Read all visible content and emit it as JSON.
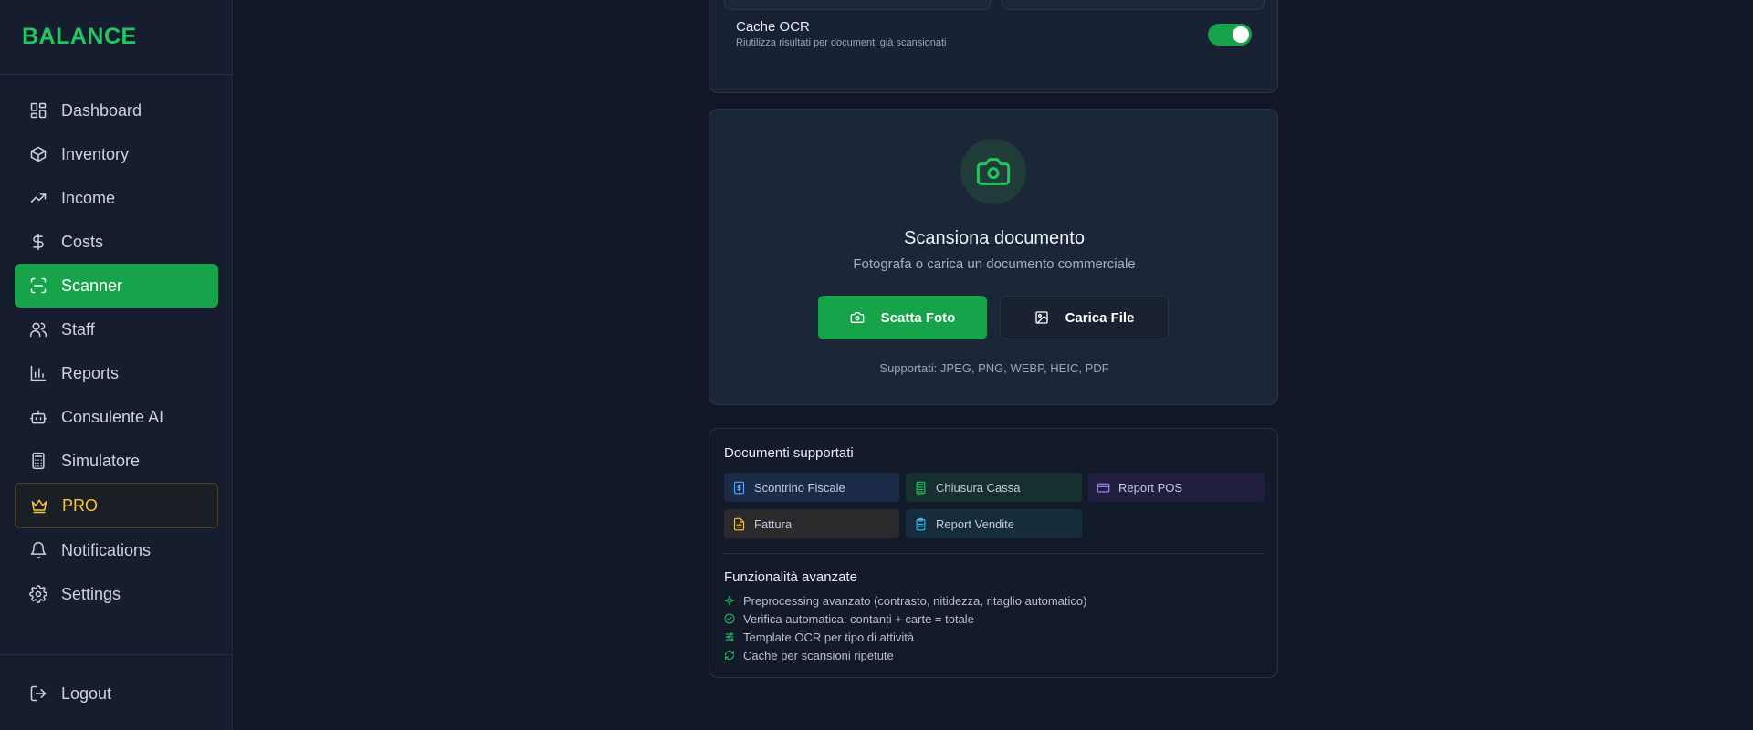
{
  "sidebar": {
    "brand": "BALANCE",
    "items": [
      {
        "label": "Dashboard",
        "icon": "dashboard-grid-icon"
      },
      {
        "label": "Inventory",
        "icon": "box-icon"
      },
      {
        "label": "Income",
        "icon": "trending-up-icon"
      },
      {
        "label": "Costs",
        "icon": "dollar-icon"
      },
      {
        "label": "Scanner",
        "icon": "scan-icon",
        "active": true
      },
      {
        "label": "Staff",
        "icon": "users-icon"
      },
      {
        "label": "Reports",
        "icon": "bar-chart-icon"
      },
      {
        "label": "Consulente AI",
        "icon": "bot-icon"
      },
      {
        "label": "Simulatore",
        "icon": "calculator-icon"
      },
      {
        "label": "PRO",
        "icon": "crown-icon"
      },
      {
        "label": "Notifications",
        "icon": "bell-icon"
      },
      {
        "label": "Settings",
        "icon": "gear-icon"
      }
    ],
    "logout": "Logout"
  },
  "settings_card": {
    "cache_title": "Cache OCR",
    "cache_subtitle": "Riutilizza risultati per documenti già scansionati",
    "cache_enabled": true
  },
  "scan_card": {
    "title": "Scansiona documento",
    "subtitle": "Fotografa o carica un documento commerciale",
    "take_photo_label": "Scatta Foto",
    "upload_label": "Carica File",
    "formats": "Supportati: JPEG, PNG, WEBP, HEIC, PDF"
  },
  "docs_card": {
    "title": "Documenti supportati",
    "chips": [
      {
        "label": "Scontrino Fiscale",
        "color": "#60a5fa",
        "bg": "#1b2b47"
      },
      {
        "label": "Chiusura Cassa",
        "color": "#22c55e",
        "bg": "#16302f"
      },
      {
        "label": "Report POS",
        "color": "#a78bfa",
        "bg": "#211f3f"
      },
      {
        "label": "Fattura",
        "color": "#f5c542",
        "bg": "#2a2a2c"
      },
      {
        "label": "Report Vendite",
        "color": "#38bdf8",
        "bg": "#152c3c"
      }
    ],
    "advanced_title": "Funzionalità avanzate",
    "features": [
      "Preprocessing avanzato (contrasto, nitidezza, ritaglio automatico)",
      "Verifica automatica: contanti + carte = totale",
      "Template OCR per tipo di attività",
      "Cache per scansioni ripetute"
    ]
  },
  "colors": {
    "accent": "#16a34a",
    "pro": "#f5c542",
    "background": "#111727"
  }
}
